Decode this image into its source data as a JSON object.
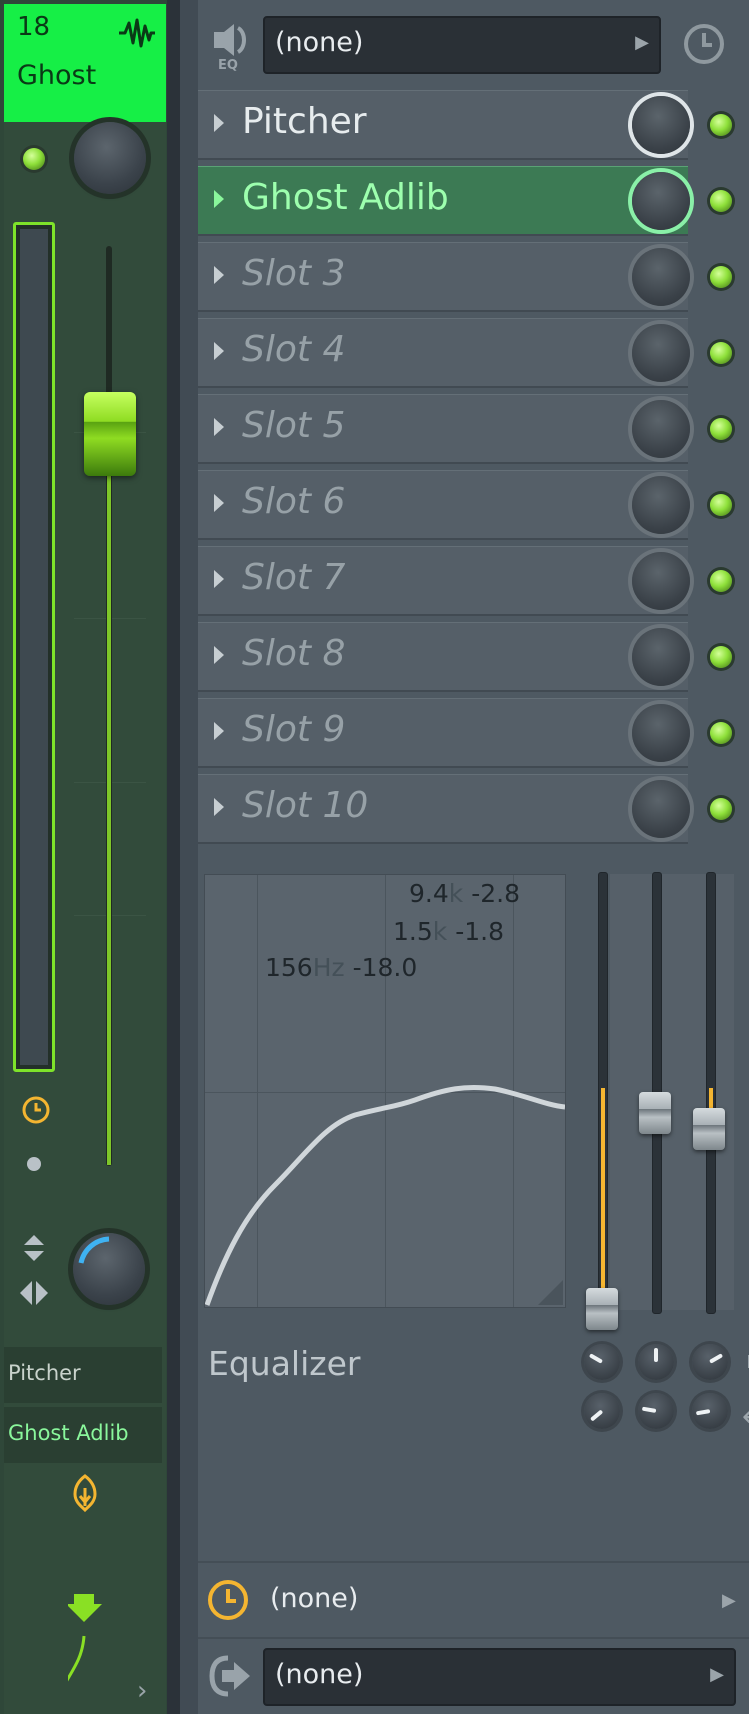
{
  "channel": {
    "number": "18",
    "name": "Ghost",
    "slots": [
      "Pitcher",
      "Ghost Adlib"
    ]
  },
  "effects": {
    "eq_label": "EQ",
    "preset": "(none)",
    "slots": [
      {
        "label": "Pitcher",
        "state": "loaded"
      },
      {
        "label": "Ghost Adlib",
        "state": "selected"
      },
      {
        "label": "Slot 3",
        "state": "empty"
      },
      {
        "label": "Slot 4",
        "state": "empty"
      },
      {
        "label": "Slot 5",
        "state": "empty"
      },
      {
        "label": "Slot 6",
        "state": "empty"
      },
      {
        "label": "Slot 7",
        "state": "empty"
      },
      {
        "label": "Slot 8",
        "state": "empty"
      },
      {
        "label": "Slot 9",
        "state": "empty"
      },
      {
        "label": "Slot 10",
        "state": "empty"
      }
    ]
  },
  "equalizer": {
    "title": "Equalizer",
    "bands": [
      {
        "freq": "156",
        "unit": "Hz",
        "gain": "-18.0"
      },
      {
        "freq": "1.5",
        "unit": "k",
        "gain": "-1.8"
      },
      {
        "freq": "9.4",
        "unit": "k",
        "gain": "-2.8"
      }
    ]
  },
  "footer": {
    "time_none": "(none)",
    "output": "(none)"
  },
  "colors": {
    "accent_green": "#16ef46",
    "selected_slot": "#3c7a54",
    "eq_gold": "#f4b531"
  }
}
